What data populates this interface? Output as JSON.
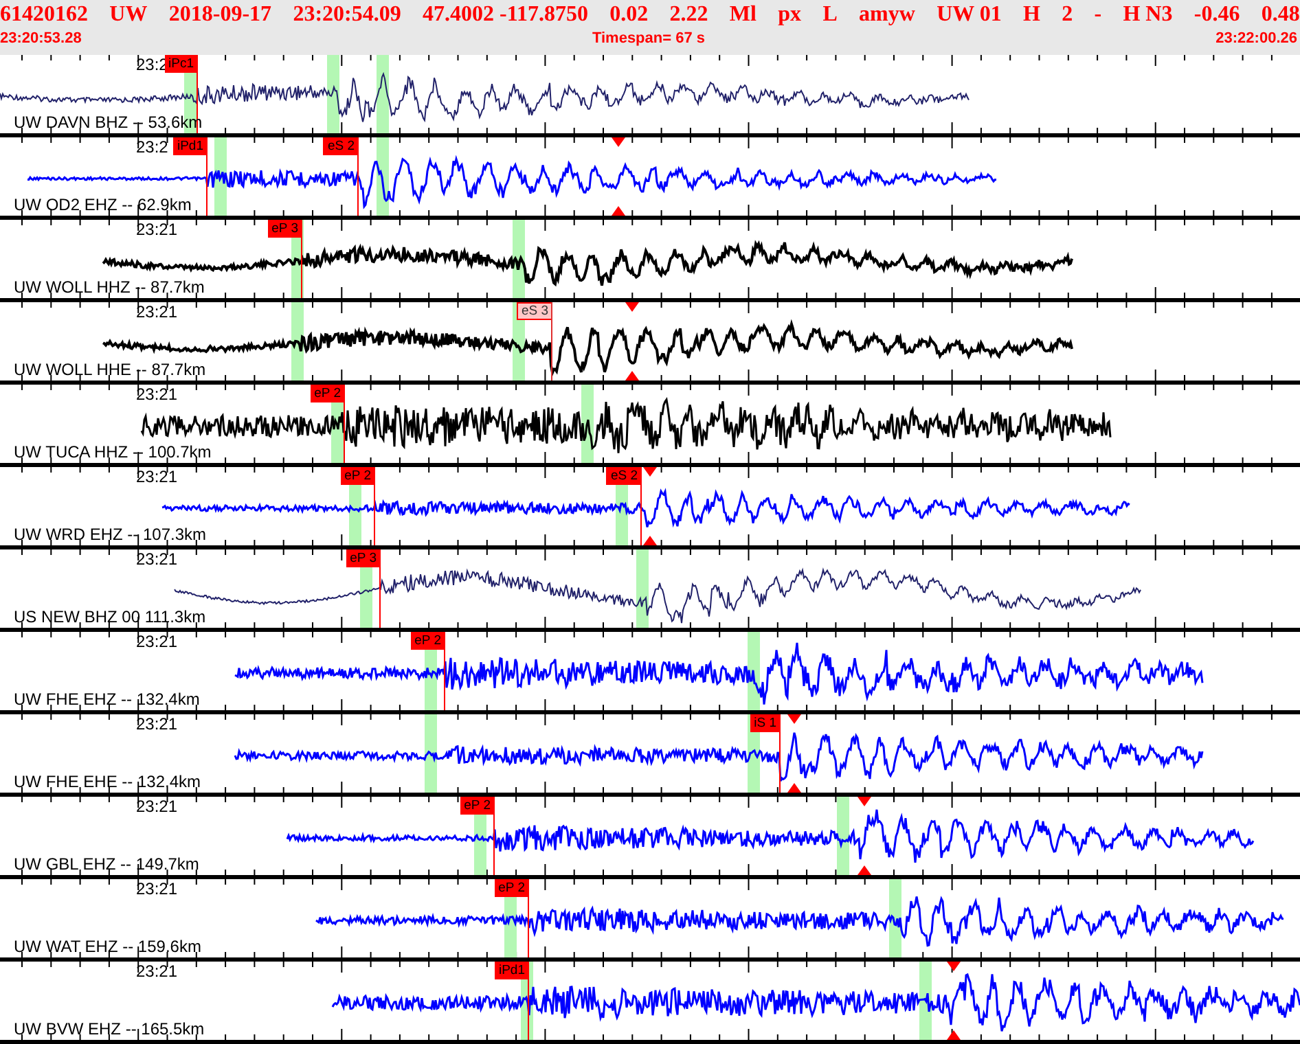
{
  "header": {
    "event_fields": [
      "61420162",
      "UW",
      "2018-09-17",
      "23:20:54.09",
      "47.4002 -117.8750",
      "0.02",
      "2.22",
      "Ml",
      "px",
      "L",
      "amyw",
      "UW 01",
      "H",
      "2",
      "-",
      "H N3",
      "-0.46",
      "0.48"
    ],
    "start_time": "23:20:53.28",
    "timespan": "Timespan=  67 s",
    "end_time": "23:22:00.26"
  },
  "traces": [
    {
      "time_label": "23:2",
      "station": "UW DAVN BHZ -- 53.6km",
      "color": "#22226a",
      "picks": [
        {
          "label": "iPc1",
          "kind": "solid"
        }
      ]
    },
    {
      "time_label": "23:2",
      "station": "UW OD2 EHZ -- 62.9km",
      "color": "#0000ff",
      "picks": [
        {
          "label": "iPd1",
          "kind": "solid"
        },
        {
          "label": "eS 2",
          "kind": "solid"
        }
      ]
    },
    {
      "time_label": "23:21",
      "station": "UW WOLL HHZ -- 87.7km",
      "color": "#000000",
      "picks": [
        {
          "label": "eP 3",
          "kind": "solid"
        }
      ]
    },
    {
      "time_label": "23:21",
      "station": "UW WOLL HHE -- 87.7km",
      "color": "#000000",
      "picks": [
        {
          "label": "eS 3",
          "kind": "outline"
        }
      ]
    },
    {
      "time_label": "23:21",
      "station": "UW TUCA HHZ -- 100.7km",
      "color": "#000000",
      "picks": [
        {
          "label": "eP 2",
          "kind": "solid"
        }
      ]
    },
    {
      "time_label": "23:21",
      "station": "UW WRD EHZ -- 107.3km",
      "color": "#0000ff",
      "picks": [
        {
          "label": "eP 2",
          "kind": "solid"
        },
        {
          "label": "eS 2",
          "kind": "solid"
        }
      ]
    },
    {
      "time_label": "23:21",
      "station": "US NEW BHZ 00 111.3km",
      "color": "#22226a",
      "picks": [
        {
          "label": "eP 3",
          "kind": "solid"
        }
      ]
    },
    {
      "time_label": "23:21",
      "station": "UW FHE EHZ -- 132.4km",
      "color": "#0000ff",
      "picks": [
        {
          "label": "eP 2",
          "kind": "solid"
        }
      ]
    },
    {
      "time_label": "23:21",
      "station": "UW FHE EHE -- 132.4km",
      "color": "#0000ff",
      "picks": [
        {
          "label": "iS 1",
          "kind": "solid"
        }
      ]
    },
    {
      "time_label": "23:21",
      "station": "UW GBL EHZ -- 149.7km",
      "color": "#0000ff",
      "picks": [
        {
          "label": "eP 2",
          "kind": "solid"
        }
      ]
    },
    {
      "time_label": "23:21",
      "station": "UW WAT EHZ -- 159.6km",
      "color": "#0000ff",
      "picks": [
        {
          "label": "eP 2",
          "kind": "solid"
        }
      ]
    },
    {
      "time_label": "23:21",
      "station": "UW BVW EHZ -- 165.5km",
      "color": "#0000ff",
      "picks": [
        {
          "label": "iPd1",
          "kind": "solid"
        }
      ]
    }
  ]
}
